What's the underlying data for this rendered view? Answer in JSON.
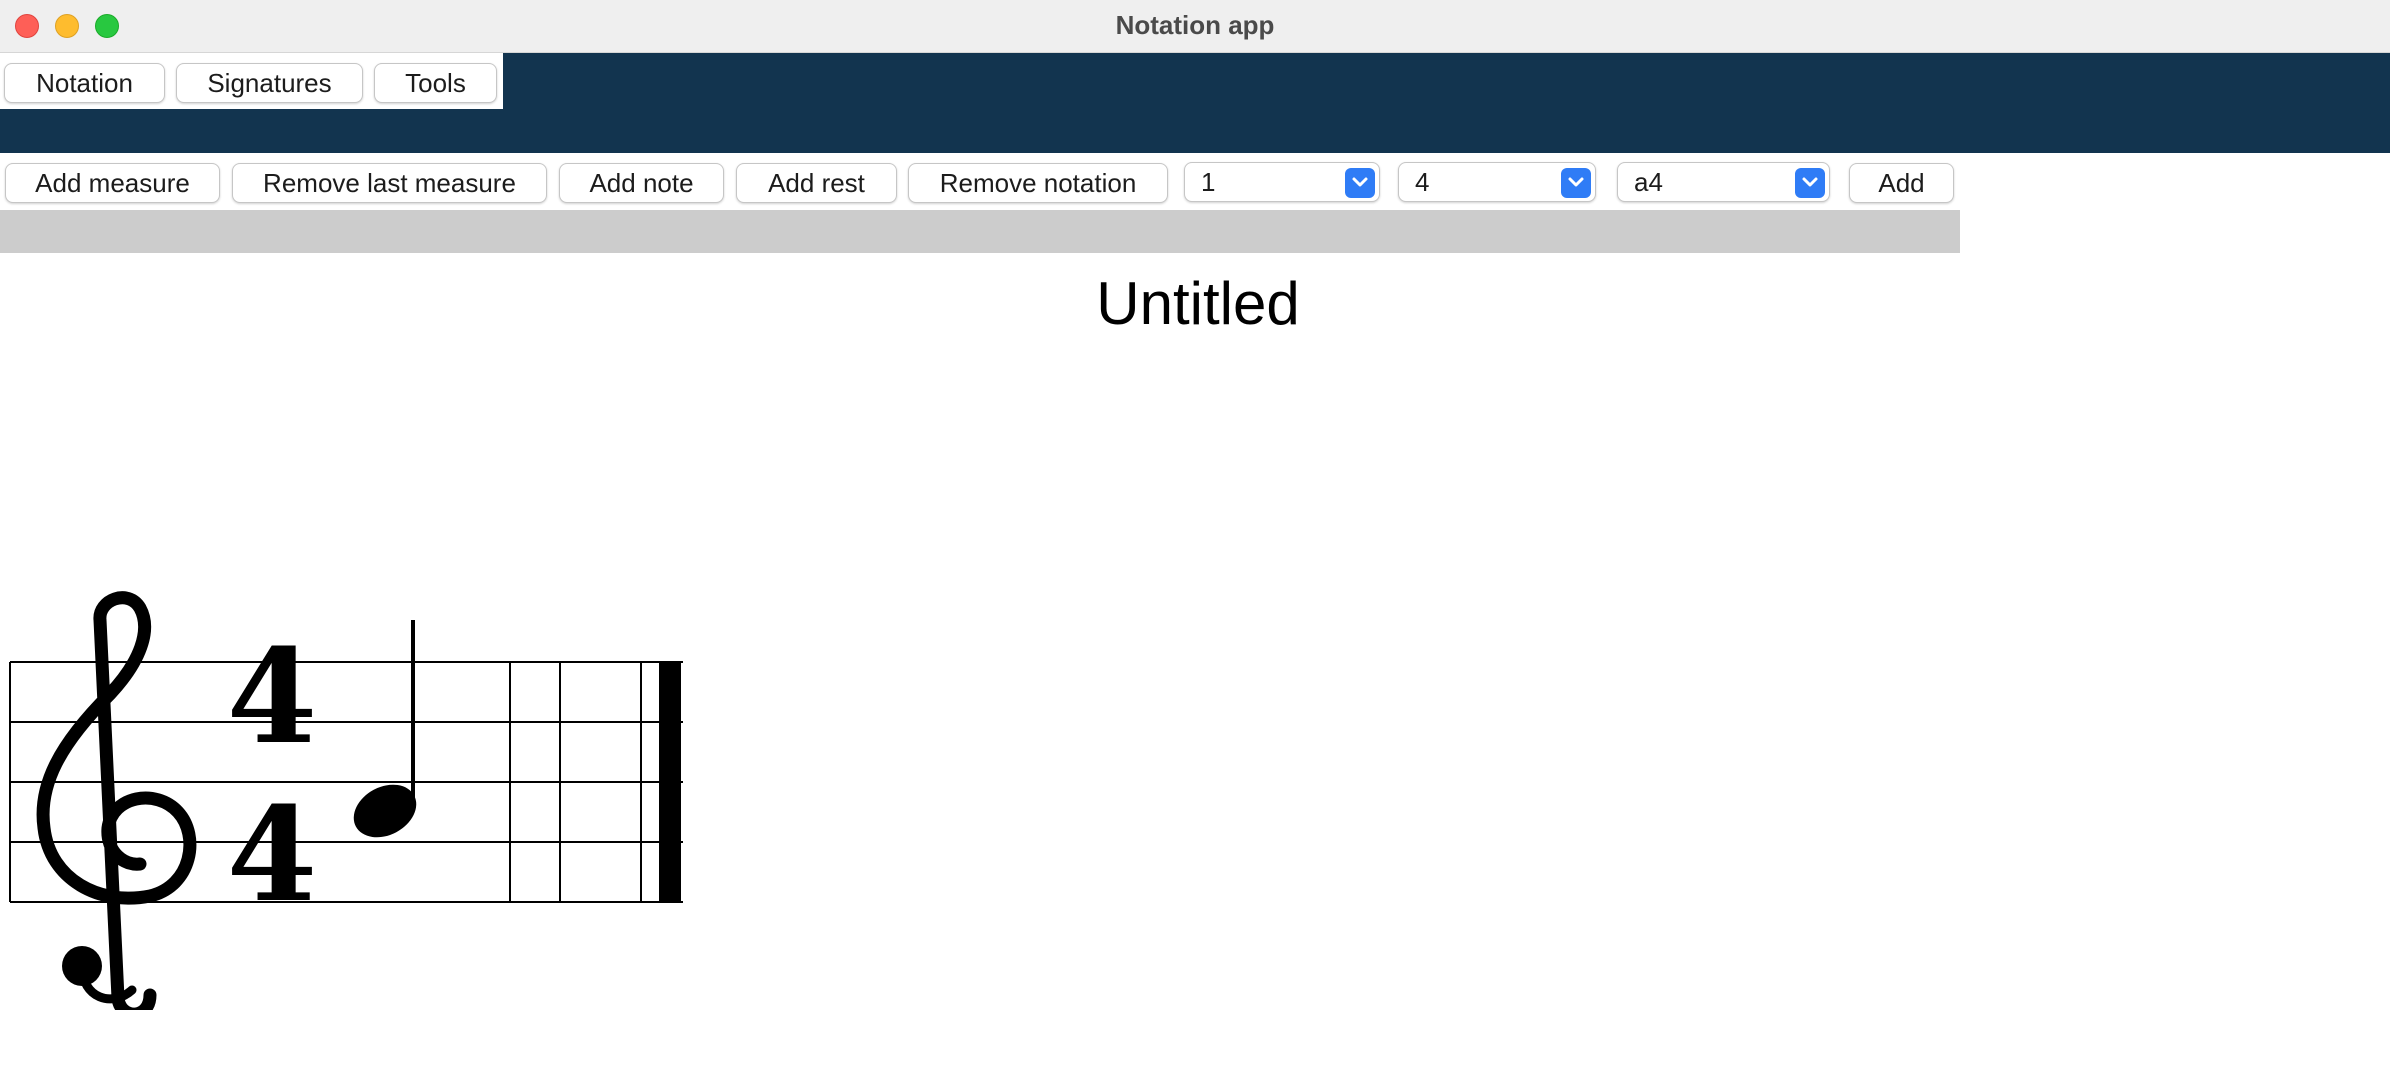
{
  "window": {
    "title": "Notation app",
    "controls": [
      "close",
      "minimize",
      "zoom"
    ]
  },
  "menu_tabs": [
    "Notation",
    "Signatures",
    "Tools"
  ],
  "toolbar": {
    "add_measure": "Add measure",
    "remove_last_measure": "Remove last measure",
    "add_note": "Add note",
    "add_rest": "Add rest",
    "remove_notation": "Remove notation",
    "select_1_value": "1",
    "select_2_value": "4",
    "select_3_value": "a4",
    "add": "Add"
  },
  "score": {
    "title": "Untitled",
    "clef": "treble-clef",
    "time_signature": {
      "top": "4",
      "bottom": "4"
    },
    "notes": [
      {
        "type": "quarter-note",
        "pitch": "a4"
      }
    ],
    "final_barline": "final-barline"
  },
  "colors": {
    "titlebar": "#efefef",
    "nav_band": "#12344f",
    "toolbar_band": "#cccccc",
    "select_accent": "#2f7cf6",
    "close": "#fe5f57",
    "minimize": "#febc2e",
    "zoom": "#28c840"
  }
}
